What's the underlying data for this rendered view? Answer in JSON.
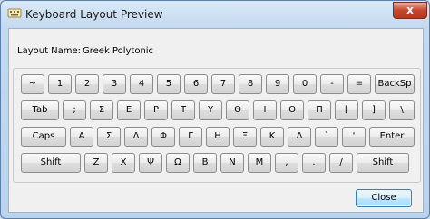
{
  "window": {
    "title": "Keyboard Layout Preview",
    "close_glyph": "x"
  },
  "layout": {
    "label": "Layout Name:",
    "value": "Greek Polytonic"
  },
  "keyboard": {
    "rows": [
      [
        "~",
        "1",
        "2",
        "3",
        "4",
        "5",
        "6",
        "7",
        "8",
        "9",
        "0",
        "-",
        "=",
        "BackSp"
      ],
      [
        "Tab",
        ";",
        "Σ",
        "Ε",
        "Ρ",
        "Τ",
        "Υ",
        "Θ",
        "Ι",
        "Ο",
        "Π",
        "[",
        "]",
        "\\"
      ],
      [
        "Caps",
        "Α",
        "Σ",
        "Δ",
        "Φ",
        "Γ",
        "Η",
        "Ξ",
        "Κ",
        "Λ",
        "`",
        "'",
        "Enter"
      ],
      [
        "Shift",
        "Ζ",
        "Χ",
        "Ψ",
        "Ω",
        "Β",
        "Ν",
        "Μ",
        ",",
        ".",
        "/",
        "Shift"
      ]
    ]
  },
  "buttons": {
    "close": "Close"
  }
}
